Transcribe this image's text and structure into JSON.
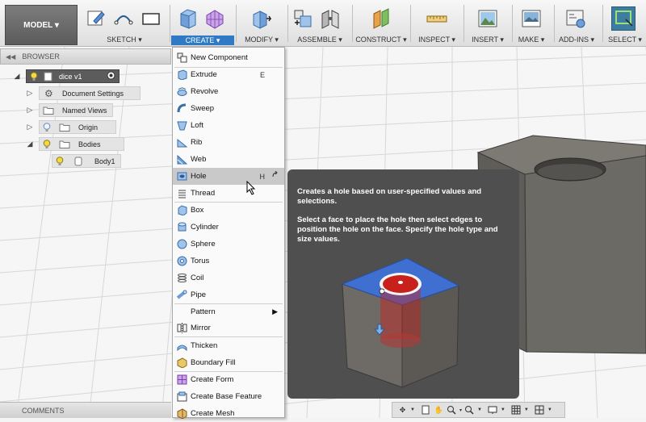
{
  "toolbar": {
    "workspace_label": "MODEL ▾",
    "groups": [
      {
        "label": "SKETCH ▾"
      },
      {
        "label": "CREATE ▾"
      },
      {
        "label": "MODIFY ▾"
      },
      {
        "label": "ASSEMBLE ▾"
      },
      {
        "label": "CONSTRUCT ▾"
      },
      {
        "label": "INSPECT ▾"
      },
      {
        "label": "INSERT ▾"
      },
      {
        "label": "MAKE ▾"
      },
      {
        "label": "ADD-INS ▾"
      },
      {
        "label": "SELECT ▾"
      }
    ]
  },
  "browser": {
    "title": "BROWSER",
    "root": "dice v1",
    "items": [
      {
        "label": "Document Settings"
      },
      {
        "label": "Named Views"
      },
      {
        "label": "Origin"
      },
      {
        "label": "Bodies"
      },
      {
        "label": "Body1"
      }
    ]
  },
  "menu": {
    "items": [
      {
        "label": "New Component",
        "shortcut": ""
      },
      {
        "label": "Extrude",
        "shortcut": "E"
      },
      {
        "label": "Revolve",
        "shortcut": ""
      },
      {
        "label": "Sweep",
        "shortcut": ""
      },
      {
        "label": "Loft",
        "shortcut": ""
      },
      {
        "label": "Rib",
        "shortcut": ""
      },
      {
        "label": "Web",
        "shortcut": ""
      },
      {
        "label": "Hole",
        "shortcut": "H"
      },
      {
        "label": "Thread",
        "shortcut": ""
      },
      {
        "label": "Box",
        "shortcut": ""
      },
      {
        "label": "Cylinder",
        "shortcut": ""
      },
      {
        "label": "Sphere",
        "shortcut": ""
      },
      {
        "label": "Torus",
        "shortcut": ""
      },
      {
        "label": "Coil",
        "shortcut": ""
      },
      {
        "label": "Pipe",
        "shortcut": ""
      },
      {
        "label": "Pattern",
        "shortcut": ""
      },
      {
        "label": "Mirror",
        "shortcut": ""
      },
      {
        "label": "Thicken",
        "shortcut": ""
      },
      {
        "label": "Boundary Fill",
        "shortcut": ""
      },
      {
        "label": "Create Form",
        "shortcut": ""
      },
      {
        "label": "Create Base Feature",
        "shortcut": ""
      },
      {
        "label": "Create Mesh",
        "shortcut": ""
      }
    ]
  },
  "tooltip": {
    "line1": "Creates a hole based on user-specified values and selections.",
    "line2": "Select a face to place the hole then select edges to position the hole on the face. Specify the hole type and size values."
  },
  "comments_label": "COMMENTS",
  "colors": {
    "accent": "#2f79c5",
    "tooltip_bg": "#4f4f4f",
    "menu_highlight": "#c9c9c9",
    "face_blue": "#3f6fd1",
    "hole_red": "#c8211c"
  }
}
